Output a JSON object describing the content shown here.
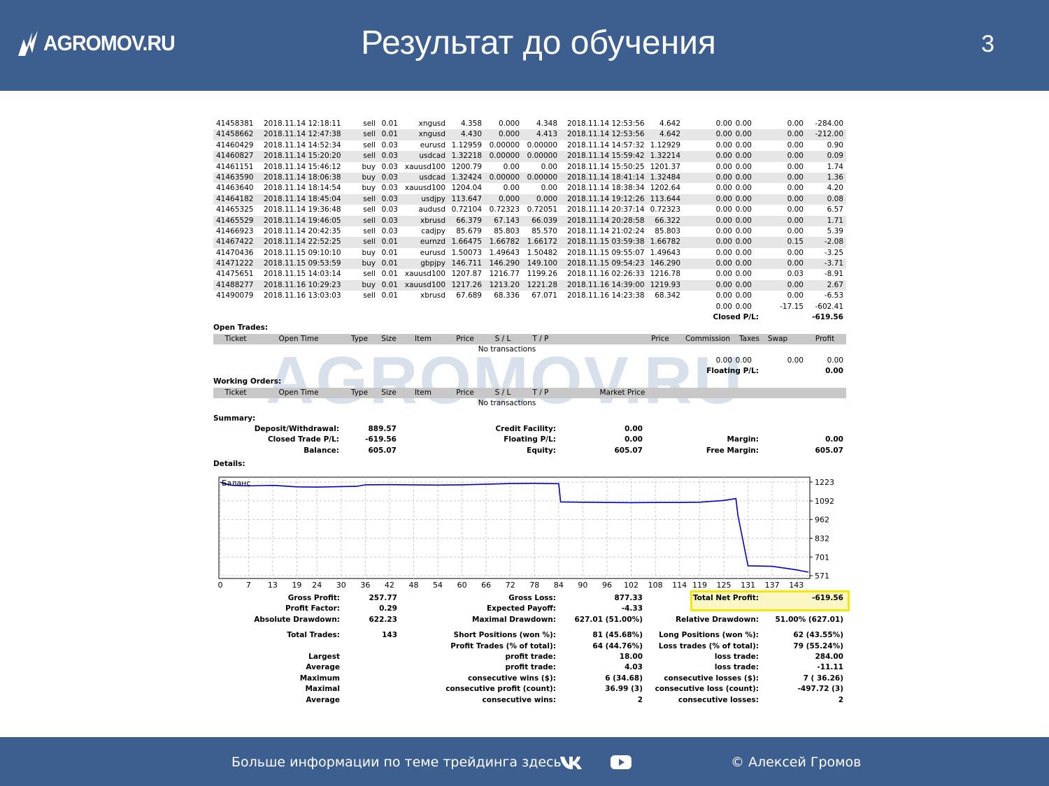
{
  "header": {
    "logo_text": "AGROMOV.RU",
    "title": "Результат до обучения",
    "page_number": "3"
  },
  "watermark": "AGROMOV.RU",
  "closed_trades": [
    [
      "41458381",
      "2018.11.14 12:18:11",
      "sell",
      "0.01",
      "xngusd",
      "4.358",
      "0.000",
      "4.348",
      "2018.11.14 12:53:56",
      "4.642",
      "0.00",
      "0.00",
      "0.00",
      "-284.00"
    ],
    [
      "41458662",
      "2018.11.14 12:47:38",
      "sell",
      "0.01",
      "xngusd",
      "4.430",
      "0.000",
      "4.413",
      "2018.11.14 12:53:56",
      "4.642",
      "0.00",
      "0.00",
      "0.00",
      "-212.00"
    ],
    [
      "41460429",
      "2018.11.14 14:52:34",
      "sell",
      "0.03",
      "eurusd",
      "1.12959",
      "0.00000",
      "0.00000",
      "2018.11.14 14:57:32",
      "1.12929",
      "0.00",
      "0.00",
      "0.00",
      "0.90"
    ],
    [
      "41460827",
      "2018.11.14 15:20:20",
      "sell",
      "0.03",
      "usdcad",
      "1.32218",
      "0.00000",
      "0.00000",
      "2018.11.14 15:59:42",
      "1.32214",
      "0.00",
      "0.00",
      "0.00",
      "0.09"
    ],
    [
      "41461151",
      "2018.11.14 15:46:12",
      "buy",
      "0.03",
      "xauusd100",
      "1200.79",
      "0.00",
      "0.00",
      "2018.11.14 15:50:25",
      "1201.37",
      "0.00",
      "0.00",
      "0.00",
      "1.74"
    ],
    [
      "41463590",
      "2018.11.14 18:06:38",
      "buy",
      "0.03",
      "usdcad",
      "1.32424",
      "0.00000",
      "0.00000",
      "2018.11.14 18:41:14",
      "1.32484",
      "0.00",
      "0.00",
      "0.00",
      "1.36"
    ],
    [
      "41463640",
      "2018.11.14 18:14:54",
      "buy",
      "0.03",
      "xauusd100",
      "1204.04",
      "0.00",
      "0.00",
      "2018.11.14 18:38:34",
      "1202.64",
      "0.00",
      "0.00",
      "0.00",
      "4.20"
    ],
    [
      "41464182",
      "2018.11.14 18:45:04",
      "sell",
      "0.03",
      "usdjpy",
      "113.647",
      "0.000",
      "0.000",
      "2018.11.14 19:12:26",
      "113.644",
      "0.00",
      "0.00",
      "0.00",
      "0.08"
    ],
    [
      "41465325",
      "2018.11.14 19:36:48",
      "sell",
      "0.03",
      "audusd",
      "0.72104",
      "0.72323",
      "0.72051",
      "2018.11.14 20:37:14",
      "0.72323",
      "0.00",
      "0.00",
      "0.00",
      "6.57"
    ],
    [
      "41465529",
      "2018.11.14 19:46:05",
      "sell",
      "0.03",
      "xbrusd",
      "66.379",
      "67.143",
      "66.039",
      "2018.11.14 20:28:58",
      "66.322",
      "0.00",
      "0.00",
      "0.00",
      "1.71"
    ],
    [
      "41466923",
      "2018.11.14 20:42:35",
      "sell",
      "0.03",
      "cadjpy",
      "85.679",
      "85.803",
      "85.570",
      "2018.11.14 21:02:24",
      "85.803",
      "0.00",
      "0.00",
      "0.00",
      "5.39"
    ],
    [
      "41467422",
      "2018.11.14 22:52:25",
      "sell",
      "0.01",
      "eurnzd",
      "1.66475",
      "1.66782",
      "1.66172",
      "2018.11.15 03:59:38",
      "1.66782",
      "0.00",
      "0.00",
      "0.15",
      "-2.08"
    ],
    [
      "41470436",
      "2018.11.15 09:10:10",
      "buy",
      "0.01",
      "eurusd",
      "1.50073",
      "1.49643",
      "1.50482",
      "2018.11.15 09:55:07",
      "1.49643",
      "0.00",
      "0.00",
      "0.00",
      "-3.25"
    ],
    [
      "41471222",
      "2018.11.15 09:53:59",
      "buy",
      "0.01",
      "gbpjpy",
      "146.711",
      "146.290",
      "149.100",
      "2018.11.15 09:54:23",
      "146.290",
      "0.00",
      "0.00",
      "0.00",
      "-3.71"
    ],
    [
      "41475651",
      "2018.11.15 14:03:14",
      "sell",
      "0.01",
      "xauusd100",
      "1207.87",
      "1216.77",
      "1199.26",
      "2018.11.16 02:26:33",
      "1216.78",
      "0.00",
      "0.00",
      "0.03",
      "-8.91"
    ],
    [
      "41488277",
      "2018.11.16 10:29:23",
      "buy",
      "0.01",
      "xauusd100",
      "1217.26",
      "1213.20",
      "1221.28",
      "2018.11.16 14:39:00",
      "1219.93",
      "0.00",
      "0.00",
      "0.00",
      "2.67"
    ],
    [
      "41490079",
      "2018.11.16 13:03:03",
      "sell",
      "0.01",
      "xbrusd",
      "67.689",
      "68.336",
      "67.071",
      "2018.11.16 14:23:38",
      "68.342",
      "0.00",
      "0.00",
      "0.00",
      "-6.53"
    ]
  ],
  "closed_totals": [
    "0.00",
    "0.00",
    "-17.15",
    "-602.41"
  ],
  "closed_pl_label": "Closed P/L:",
  "closed_pl_value": "-619.56",
  "open_trades": {
    "title": "Open Trades:",
    "headers": [
      "Ticket",
      "Open Time",
      "Type",
      "Size",
      "Item",
      "Price",
      "S / L",
      "T / P",
      "Price",
      "Commission",
      "Taxes",
      "Swap",
      "Profit"
    ],
    "empty": "No transactions",
    "totals": [
      "0.00",
      "0.00",
      "0.00",
      "0.00"
    ],
    "floating_label": "Floating P/L:",
    "floating_value": "0.00"
  },
  "working_orders": {
    "title": "Working Orders:",
    "headers": [
      "Ticket",
      "Open Time",
      "Type",
      "Size",
      "Item",
      "Price",
      "S / L",
      "T / P",
      "Market Price"
    ],
    "empty": "No transactions"
  },
  "summary": {
    "title": "Summary:",
    "deposit_label": "Deposit/Withdrawal:",
    "deposit_value": "889.57",
    "credit_label": "Credit Facility:",
    "credit_value": "0.00",
    "closed_label": "Closed Trade P/L:",
    "closed_value": "-619.56",
    "floating_label": "Floating P/L:",
    "floating_value": "0.00",
    "margin_label": "Margin:",
    "margin_value": "0.00",
    "balance_label": "Balance:",
    "balance_value": "605.07",
    "equity_label": "Equity:",
    "equity_value": "605.07",
    "free_margin_label": "Free Margin:",
    "free_margin_value": "605.07"
  },
  "details_title": "Details:",
  "chart_data": {
    "type": "line",
    "title": "Баланс",
    "x_ticks": [
      "0",
      "7",
      "13",
      "19",
      "24",
      "30",
      "36",
      "42",
      "48",
      "54",
      "60",
      "66",
      "72",
      "78",
      "84",
      "90",
      "96",
      "102",
      "108",
      "114",
      "119",
      "125",
      "131",
      "137",
      "143"
    ],
    "y_ticks": [
      "1223",
      "1092",
      "962",
      "832",
      "701",
      "571"
    ],
    "ylim": [
      571,
      1223
    ],
    "xlim": [
      0,
      146
    ],
    "grid": true,
    "color": "#0000c8",
    "series": [
      {
        "x": [
          0,
          1,
          3,
          7,
          13,
          19,
          24,
          30,
          34,
          36,
          42,
          54,
          60,
          66,
          72,
          78,
          84,
          84.5,
          90,
          96,
          102,
          108,
          114,
          119,
          125,
          128,
          128.5,
          131,
          137,
          143,
          146
        ],
        "y": [
          1223,
          1212,
          1200,
          1196,
          1200,
          1190,
          1188,
          1192,
          1194,
          1204,
          1205,
          1202,
          1204,
          1208,
          1213,
          1214,
          1212,
          1085,
          1083,
          1081,
          1080,
          1081,
          1081,
          1083,
          1095,
          1108,
          990,
          640,
          636,
          612,
          596
        ]
      }
    ]
  },
  "stats": {
    "gross_profit_label": "Gross Profit:",
    "gross_profit": "257.77",
    "gross_loss_label": "Gross Loss:",
    "gross_loss": "877.33",
    "total_net_label": "Total Net Profit:",
    "total_net": "-619.56",
    "profit_factor_label": "Profit Factor:",
    "profit_factor": "0.29",
    "expected_payoff_label": "Expected Payoff:",
    "expected_payoff": "-4.33",
    "abs_dd_label": "Absolute Drawdown:",
    "abs_dd": "622.23",
    "max_dd_label": "Maximal Drawdown:",
    "max_dd": "627.01 (51.00%)",
    "rel_dd_label": "Relative Drawdown:",
    "rel_dd": "51.00% (627.01)",
    "total_trades_label": "Total Trades:",
    "total_trades": "143",
    "short_label": "Short Positions (won %):",
    "short": "81 (45.68%)",
    "long_label": "Long Positions (won %):",
    "long": "62 (43.55%)",
    "profit_trades_label": "Profit Trades (% of total):",
    "profit_trades": "64 (44.76%)",
    "loss_trades_label": "Loss trades (% of total):",
    "loss_trades": "79 (55.24%)",
    "largest_label": "Largest",
    "largest_pt_label": "profit trade:",
    "largest_pt": "18.00",
    "largest_lt_label": "loss trade:",
    "largest_lt": "284.00",
    "average_label": "Average",
    "average_pt_label": "profit trade:",
    "average_pt": "4.03",
    "average_lt_label": "loss trade:",
    "average_lt": "-11.11",
    "maximum_label": "Maximum",
    "max_cw_label": "consecutive wins ($):",
    "max_cw": "6 (34.68)",
    "max_cl_label": "consecutive losses ($):",
    "max_cl": "7 ( 36.26)",
    "maximal_label": "Maximal",
    "maximal_cp_label": "consecutive profit (count):",
    "maximal_cp": "36.99 (3)",
    "maximal_cl_label": "consecutive loss (count):",
    "maximal_cl": "-497.72 (3)",
    "average2_label": "Average",
    "avg_cw_label": "consecutive wins:",
    "avg_cw": "2",
    "avg_cl_label": "consecutive losses:",
    "avg_cl": "2"
  },
  "footer": {
    "more": "Больше информации по теме трейдинга здесь",
    "vk_icon": "vk-icon",
    "youtube_icon": "youtube-icon",
    "copyright": "© Алексей Громов"
  }
}
